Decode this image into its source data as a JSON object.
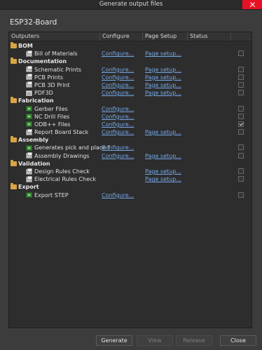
{
  "window": {
    "title": "Generate output files",
    "project": "ESP32-Board"
  },
  "columns": [
    "Outputers",
    "Configure",
    "Page Setup",
    "Status"
  ],
  "categories": [
    {
      "name": "BOM",
      "items": [
        {
          "label": "Bill of Materials",
          "icon": "bom-icon",
          "configure": "Configure...",
          "page_setup": "Page setup...",
          "checked": false
        }
      ]
    },
    {
      "name": "Documentation",
      "items": [
        {
          "label": "Schematic Prints",
          "icon": "print-icon",
          "configure": "Configure...",
          "page_setup": "Page setup...",
          "checked": false
        },
        {
          "label": "PCB Prints",
          "icon": "print-icon",
          "configure": "Configure...",
          "page_setup": "Page setup...",
          "checked": false
        },
        {
          "label": "PCB 3D Print",
          "icon": "print-icon",
          "configure": "Configure...",
          "page_setup": "Page setup...",
          "checked": false
        },
        {
          "label": "PDF3D",
          "icon": "doc-icon",
          "configure": "Configure...",
          "page_setup": "Page setup...",
          "checked": false
        }
      ]
    },
    {
      "name": "Fabrication",
      "items": [
        {
          "label": "Gerber Files",
          "icon": "fabrication-icon",
          "configure": "Configure...",
          "page_setup": "",
          "checked": false
        },
        {
          "label": "NC Drill Files",
          "icon": "fabrication-icon",
          "configure": "Configure...",
          "page_setup": "",
          "checked": false
        },
        {
          "label": "ODB++ Files",
          "icon": "fabrication-icon",
          "configure": "Configure...",
          "page_setup": "",
          "checked": true
        },
        {
          "label": "Report Board Stack",
          "icon": "print-icon",
          "configure": "Configure...",
          "page_setup": "Page setup...",
          "checked": false
        }
      ]
    },
    {
      "name": "Assembly",
      "items": [
        {
          "label": "Generates pick and place f",
          "icon": "fabrication-icon",
          "configure": "Configure...",
          "page_setup": "",
          "checked": false
        },
        {
          "label": "Assembly Drawings",
          "icon": "print-icon",
          "configure": "Configure...",
          "page_setup": "Page setup...",
          "checked": false
        }
      ]
    },
    {
      "name": "Validation",
      "items": [
        {
          "label": "Design Rules Check",
          "icon": "print-icon",
          "configure": "",
          "page_setup": "Page setup...",
          "checked": false
        },
        {
          "label": "Electrical Rules Check",
          "icon": "print-icon",
          "configure": "",
          "page_setup": "Page setup...",
          "checked": false
        }
      ]
    },
    {
      "name": "Export",
      "items": [
        {
          "label": "Export STEP",
          "icon": "fabrication-icon",
          "configure": "Configure...",
          "page_setup": "",
          "checked": false
        }
      ]
    }
  ],
  "buttons": {
    "generate": "Generate",
    "view": "View",
    "release": "Release",
    "close": "Close"
  }
}
